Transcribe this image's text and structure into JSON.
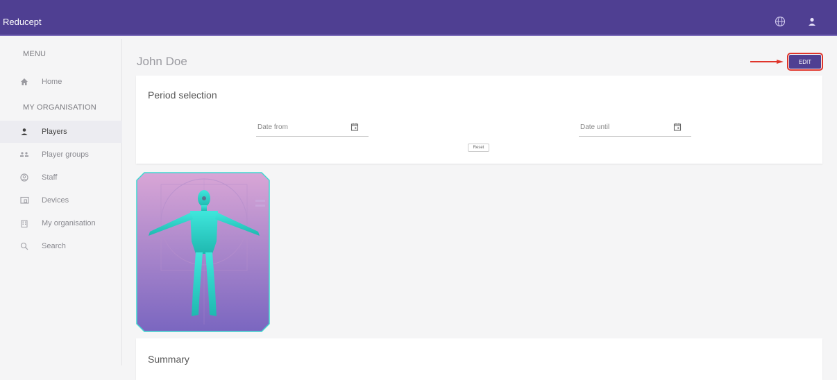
{
  "app": {
    "title": "Reducept"
  },
  "topbar": {
    "icons": [
      "globe-icon",
      "user-icon"
    ]
  },
  "sidebar": {
    "menu_header": "MENU",
    "org_header": "MY ORGANISATION",
    "home": {
      "label": "Home",
      "icon": "home-icon"
    },
    "items": [
      {
        "label": "Players",
        "icon": "person-icon",
        "active": true
      },
      {
        "label": "Player groups",
        "icon": "group-icon",
        "active": false
      },
      {
        "label": "Staff",
        "icon": "account-circle-icon",
        "active": false
      },
      {
        "label": "Devices",
        "icon": "devices-icon",
        "active": false
      },
      {
        "label": "My organisation",
        "icon": "building-icon",
        "active": false
      },
      {
        "label": "Search",
        "icon": "search-icon",
        "active": false
      }
    ]
  },
  "page": {
    "title": "John Doe",
    "edit_label": "EDIT"
  },
  "period": {
    "title": "Period selection",
    "date_from_placeholder": "Date from",
    "date_until_placeholder": "Date until",
    "reset_label": "Reset"
  },
  "summary": {
    "title": "Summary"
  },
  "colors": {
    "primary": "#4f3f92",
    "highlight": "#e0352b",
    "figure": "#2fd9cf"
  }
}
